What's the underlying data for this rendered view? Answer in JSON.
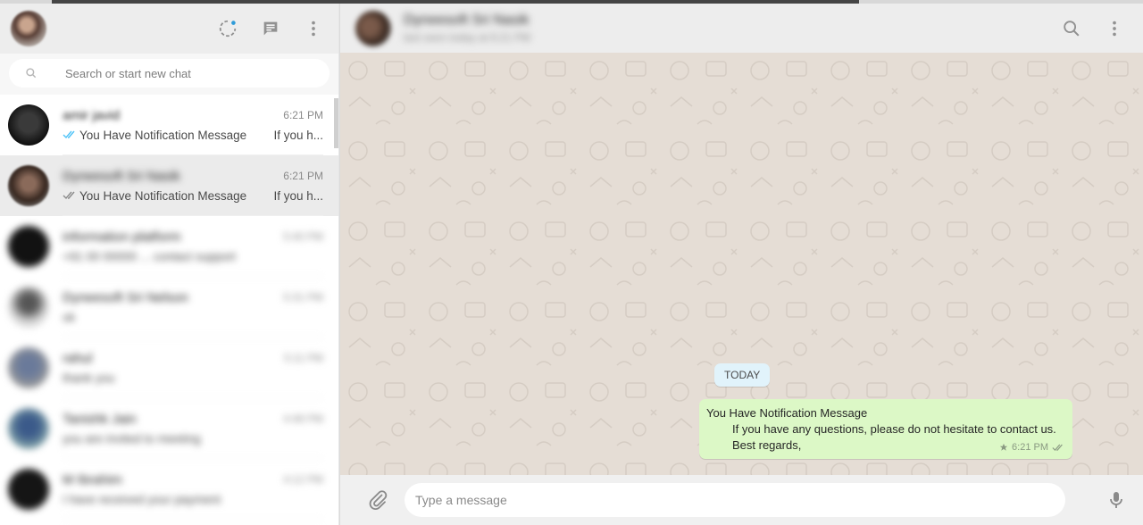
{
  "sidebar": {
    "search_placeholder": "Search or start new chat",
    "chats": [
      {
        "name": "amir javid",
        "time": "6:21 PM",
        "preview": "You Have Notification Message",
        "extra": "If you h...",
        "ticks": "read",
        "blurred": false
      },
      {
        "name": "Dyneesoft Sri Nasik",
        "time": "6:21 PM",
        "preview": "You Have Notification Message",
        "extra": "If you h...",
        "ticks": "delivered",
        "blurred": false
      },
      {
        "name": "information platform",
        "time": "5:40 PM",
        "preview": "+91 00 00000 ... contact support",
        "extra": "",
        "ticks": "",
        "blurred": true
      },
      {
        "name": "Dyneesoft Sri Nelson",
        "time": "5:31 PM",
        "preview": "ok",
        "extra": "",
        "ticks": "",
        "blurred": true
      },
      {
        "name": "rahul",
        "time": "5:11 PM",
        "preview": "thank you",
        "extra": "",
        "ticks": "",
        "blurred": true
      },
      {
        "name": "Tanishk Jain",
        "time": "4:48 PM",
        "preview": "you are invited to meeting",
        "extra": "",
        "ticks": "",
        "blurred": true
      },
      {
        "name": "M Ibrahim",
        "time": "4:12 PM",
        "preview": "I have received your payment",
        "extra": "",
        "ticks": "",
        "blurred": true
      }
    ]
  },
  "conversation": {
    "contact_name": "Dyneesoft Sri Nasik",
    "contact_status": "last seen today at 6:21 PM",
    "date_label": "TODAY",
    "message": {
      "line1": "You Have Notification Message",
      "line2": "If you have any questions, please do not hesitate to contact us.",
      "line3": "Best regards,",
      "time": "6:21 PM"
    },
    "compose_placeholder": "Type a message"
  },
  "colors": {
    "outgoing_bubble": "#dcf8c6",
    "date_pill": "#e1f3fb",
    "chat_background": "#e5ddd5",
    "read_tick": "#4fc3f7"
  },
  "icons": {
    "status": "status-icon",
    "new_chat": "new-chat-icon",
    "menu": "menu-icon",
    "search": "search-icon",
    "attach": "paperclip-icon",
    "mic": "microphone-icon",
    "star": "star-icon"
  }
}
